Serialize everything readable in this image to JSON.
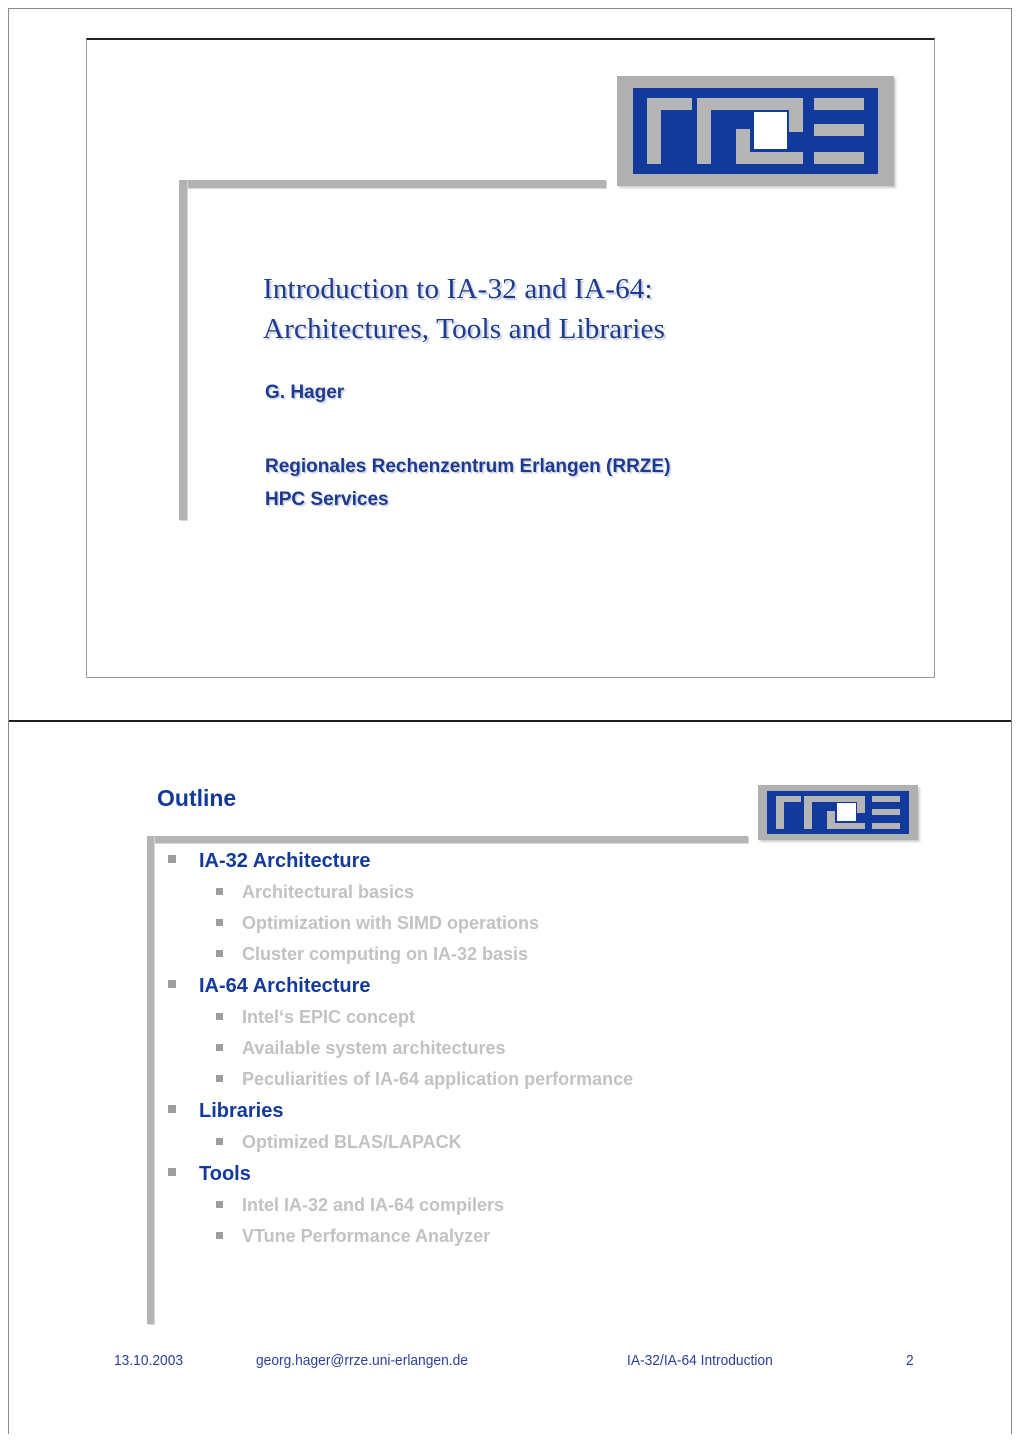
{
  "deck": {
    "page_number": "2"
  },
  "slide1": {
    "title_line1": "Introduction to IA-32 and IA-64:",
    "title_line2": "Architectures, Tools and Libraries",
    "author": "G. Hager",
    "org_line1": "Regionales Rechenzentrum Erlangen (RRZE)",
    "org_line2": "HPC Services",
    "logo_alt": "RRZE"
  },
  "slide2": {
    "heading": "Outline",
    "logo_alt": "RRZE",
    "outline": [
      {
        "level": 1,
        "text": "IA-32 Architecture"
      },
      {
        "level": 2,
        "text": "Architectural basics"
      },
      {
        "level": 2,
        "text": "Optimization with SIMD operations"
      },
      {
        "level": 2,
        "text": "Cluster computing on IA-32 basis"
      },
      {
        "level": 1,
        "text": "IA-64 Architecture"
      },
      {
        "level": 2,
        "text": "Intel‘s EPIC concept"
      },
      {
        "level": 2,
        "text": "Available system architectures"
      },
      {
        "level": 2,
        "text": "Peculiarities of IA-64 application performance"
      },
      {
        "level": 1,
        "text": "Libraries"
      },
      {
        "level": 2,
        "text": "Optimized BLAS/LAPACK"
      },
      {
        "level": 1,
        "text": "Tools"
      },
      {
        "level": 2,
        "text": "Intel IA-32 and IA-64 compilers"
      },
      {
        "level": 2,
        "text": "VTune Performance Analyzer"
      }
    ],
    "footer": {
      "date": "13.10.2003",
      "email": "georg.hager@rrze.uni-erlangen.de",
      "topic": "IA-32/IA-64 Introduction",
      "page": "2"
    }
  },
  "colors": {
    "brand_blue": "#123a9c",
    "title_blue": "#1c3a8e",
    "rule_gray": "#b5b5b5",
    "sub_gray": "#c2c2c2",
    "logo_gray": "#b0b0b0"
  }
}
